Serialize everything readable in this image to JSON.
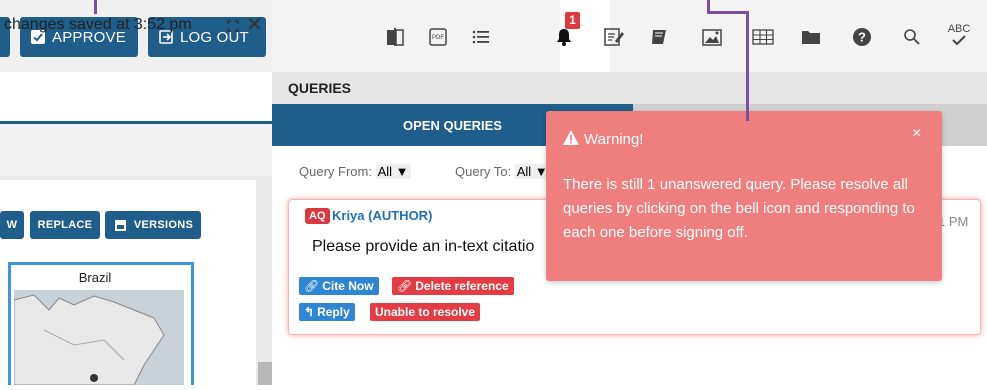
{
  "left": {
    "toolbar": {
      "approve_label": "APPROVE",
      "logout_label": "LOG OUT"
    },
    "status_text": "changes saved at 3:52 pm",
    "image_buttons": {
      "replace": "REPLACE",
      "versions": "VERSIONS",
      "partial": "W"
    },
    "figure_title": "Brazil"
  },
  "toolbar": {
    "icons": [
      "split-view-icon",
      "pdf-icon",
      "list-icon",
      "bell-icon",
      "edit-icon",
      "book-icon",
      "image-icon",
      "table-icon",
      "folder-icon",
      "help-icon",
      "search-icon",
      "spellcheck-icon"
    ],
    "bell_badge": "1",
    "pdf_text": "PDF",
    "abc_text": "ABC"
  },
  "queries": {
    "title": "QUERIES",
    "tab_open": "OPEN QUERIES",
    "query_from_label": "Query From:",
    "query_from_value": "All ▼",
    "query_to_label": "Query To:",
    "query_to_value": "All ▼"
  },
  "query": {
    "badge": "AQ",
    "author": "Kriya (AUTHOR)",
    "time": "1 PM",
    "text": "Please provide an in-text citatio",
    "cite_now": "Cite Now",
    "delete_reference": "Delete reference",
    "reply": "Reply",
    "unable": "Unable to resolve"
  },
  "warning": {
    "title": "Warning!",
    "close": "×",
    "body": "There is still 1 unanswered query. Please resolve all queries by clicking on the bell icon and responding to each one before signing off."
  },
  "colors": {
    "primary": "#1f5d8a",
    "warning_bg": "#ef7e7e",
    "danger": "#e33c45",
    "link_blue": "#2f86d3",
    "annotation": "#7b4f9e"
  }
}
